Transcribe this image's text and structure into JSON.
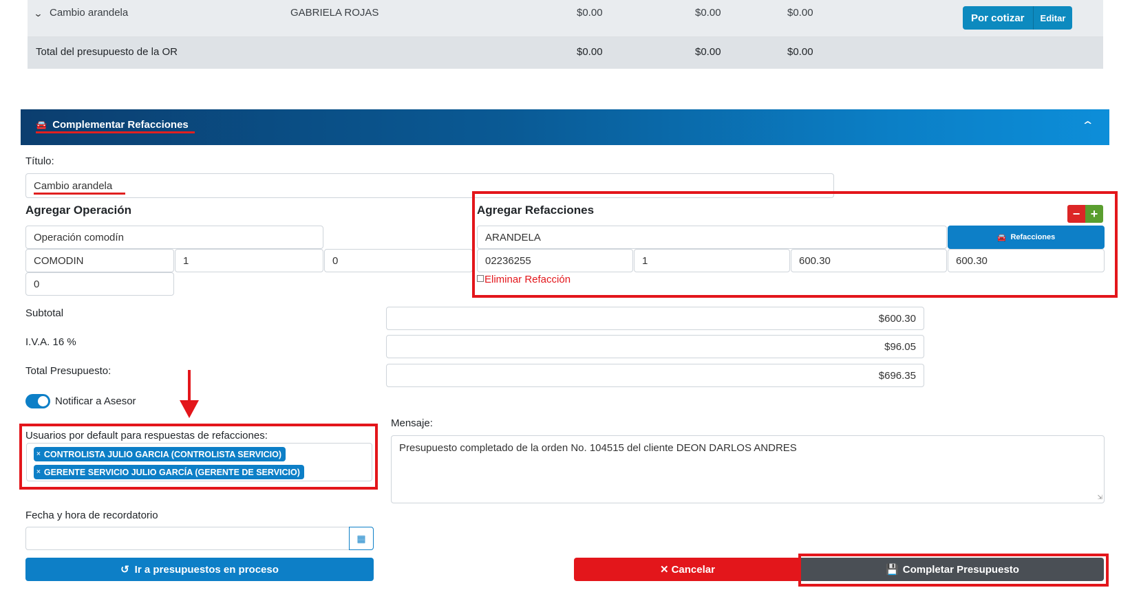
{
  "top_table": {
    "row": {
      "title": "Cambio arandela",
      "user": "GABRIELA ROJAS",
      "amount1": "$0.00",
      "amount2": "$0.00",
      "amount3": "$0.00",
      "status_button": "Por cotizar",
      "edit_button": "Editar"
    },
    "total": {
      "label": "Total del presupuesto de la OR",
      "amount1": "$0.00",
      "amount2": "$0.00",
      "amount3": "$0.00"
    }
  },
  "panel": {
    "title": "Complementar Refacciones",
    "icon": "car-icon",
    "collapse_icon": "chevron-up-icon"
  },
  "form": {
    "titulo_label": "Título:",
    "titulo_value": "Cambio arandela",
    "agregar_operacion": {
      "heading": "Agregar Operación",
      "operation_name": "Operación comodín",
      "code": "COMODIN",
      "quantity": "1",
      "price": "0",
      "total": "0"
    },
    "agregar_refacciones": {
      "heading": "Agregar Refacciones",
      "part_name": "ARANDELA",
      "refacciones_button": "Refacciones",
      "part_number": "02236255",
      "quantity": "1",
      "unit_price": "600.30",
      "total": "600.30",
      "delete_label": "Eliminar Refacción"
    },
    "subtotal_label": "Subtotal",
    "subtotal_value": "$600.30",
    "iva_label": "I.V.A. 16 %",
    "iva_value": "$96.05",
    "total_label": "Total Presupuesto:",
    "total_value": "$696.35",
    "notify_label": "Notificar a Asesor",
    "notify_on": true,
    "default_users_label": "Usuarios por default para respuestas de refacciones:",
    "default_users": [
      "CONTROLISTA JULIO GARCIA (CONTROLISTA SERVICIO)",
      "GERENTE SERVICIO JULIO GARCÍA (GERENTE DE SERVICIO)"
    ],
    "mensaje_label": "Mensaje:",
    "mensaje_value": "Presupuesto completado de la orden No. 104515 del cliente DEON DARLOS ANDRES",
    "reminder_label": "Fecha y hora de recordatorio",
    "reminder_value": ""
  },
  "buttons": {
    "in_process": "Ir a presupuestos en proceso",
    "cancel": "Cancelar",
    "complete": "Completar Presupuesto"
  },
  "colors": {
    "primary": "#0d7fc7",
    "danger": "#e3161b",
    "success": "#5a9e2f",
    "dark": "#4a4f55",
    "annotation": "#e3161b"
  }
}
